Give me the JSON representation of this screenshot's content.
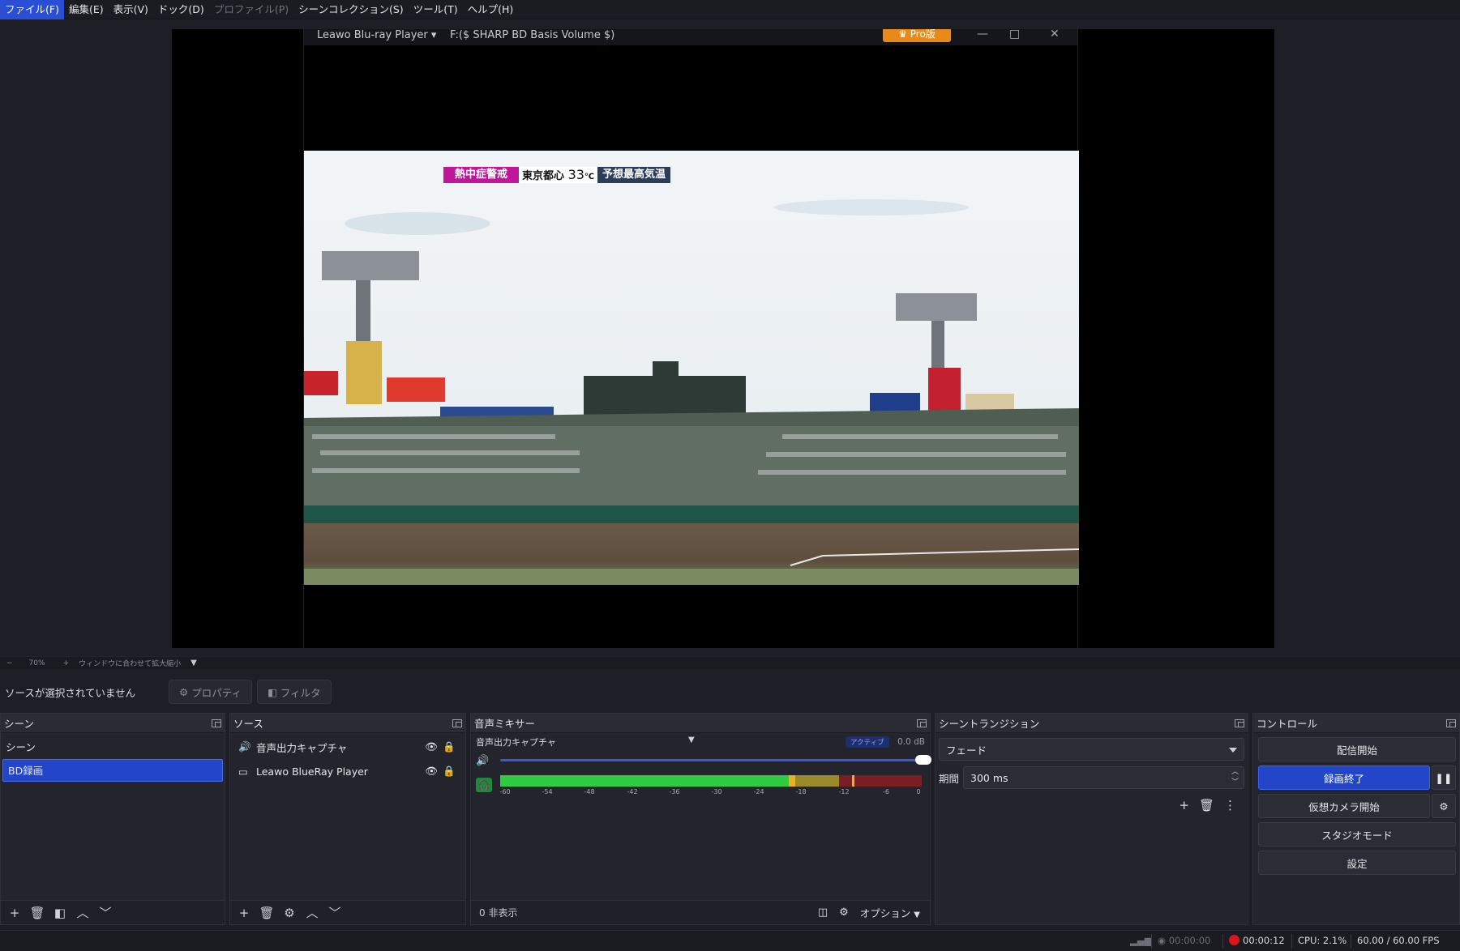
{
  "menu": [
    {
      "label": "ファイル(F)",
      "state": "active"
    },
    {
      "label": "編集(E)",
      "state": "normal"
    },
    {
      "label": "表示(V)",
      "state": "normal"
    },
    {
      "label": "ドック(D)",
      "state": "normal"
    },
    {
      "label": "プロファイル(P)",
      "state": "disabled"
    },
    {
      "label": "シーンコレクション(S)",
      "state": "normal"
    },
    {
      "label": "ツール(T)",
      "state": "normal"
    },
    {
      "label": "ヘルプ(H)",
      "state": "normal"
    }
  ],
  "player": {
    "app_name": "Leawo Blu-ray Player ▾",
    "path": "F:($ SHARP BD Basis Volume $)",
    "pro_badge": "♛ Pro版",
    "ticker": {
      "alert": "熱中症警戒",
      "location": "東京都心",
      "temp": "33",
      "unit": "℃",
      "label": "予想最高気温"
    }
  },
  "zoom": {
    "minus": "−",
    "level": "70%",
    "plus": "+",
    "fit_label": "ウィンドウに合わせて拡大縮小"
  },
  "context": {
    "no_source": "ソースが選択されていません",
    "properties": "プロパティ",
    "filters": "フィルタ"
  },
  "scenes": {
    "title": "シーン",
    "items": [
      {
        "label": "シーン",
        "selected": false
      },
      {
        "label": "BD録画",
        "selected": true
      }
    ]
  },
  "sources": {
    "title": "ソース",
    "items": [
      {
        "label": "音声出力キャプチャ",
        "icon": "speaker-icon"
      },
      {
        "label": "Leawo BlueRay Player",
        "icon": "window-icon"
      }
    ]
  },
  "mixer": {
    "title": "音声ミキサー",
    "channel": "音声出力キャプチャ",
    "active_badge": "アクティブ",
    "db": "0.0 dB",
    "volume": 1.0,
    "meter_ticks": [
      "-60",
      "-54",
      "-48",
      "-42",
      "-36",
      "-30",
      "-24",
      "-18",
      "-12",
      "-6",
      "0"
    ],
    "hidden_count": "0 非表示",
    "options": "オプション"
  },
  "transitions": {
    "title": "シーントランジション",
    "selected": "フェード",
    "duration_label": "期間",
    "duration_value": "300 ms"
  },
  "controls": {
    "title": "コントロール",
    "start_stream": "配信開始",
    "stop_record": "録画終了",
    "start_vcam": "仮想カメラ開始",
    "studio_mode": "スタジオモード",
    "settings": "設定"
  },
  "status": {
    "stream_time": "00:00:00",
    "rec_time": "00:00:12",
    "cpu": "CPU: 2.1%",
    "fps": "60.00 / 60.00 FPS"
  },
  "colors": {
    "accent": "#2346c9",
    "rec_red": "#d3181e",
    "meter_green": "#2ecc40",
    "meter_yellow": "#e6b422",
    "meter_red": "#c0392b"
  }
}
